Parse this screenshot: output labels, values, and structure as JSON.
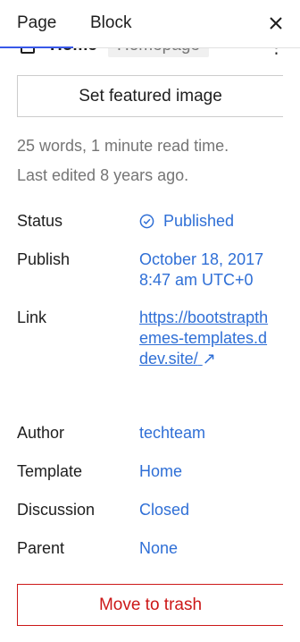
{
  "tabs": {
    "page_label": "Page",
    "block_label": "Block",
    "close_icon": "close-icon"
  },
  "summary": {
    "title": "Home",
    "badge": "Homepage",
    "menu_glyph": "⋮"
  },
  "featured_image": {
    "label": "Set featured image"
  },
  "meta": {
    "words": "25 words, 1 minute read time.",
    "edited": "Last edited 8 years ago."
  },
  "fields": {
    "status": {
      "label": "Status",
      "value": "Published"
    },
    "publish": {
      "label": "Publish",
      "value_line1": "October 18, 2017",
      "value_line2": "8:47 am UTC+0"
    },
    "link": {
      "label": "Link",
      "value": "https://bootstrapthemes-templates.ddev.site/",
      "external_glyph": "↗"
    },
    "author": {
      "label": "Author",
      "value": "techteam"
    },
    "template": {
      "label": "Template",
      "value": "Home"
    },
    "discussion": {
      "label": "Discussion",
      "value": "Closed"
    },
    "parent": {
      "label": "Parent",
      "value": "None"
    }
  },
  "trash": {
    "label": "Move to trash"
  },
  "colors": {
    "accent": "#3858e9",
    "link": "#2f6fd6",
    "danger": "#cc1818",
    "muted": "#757575"
  }
}
